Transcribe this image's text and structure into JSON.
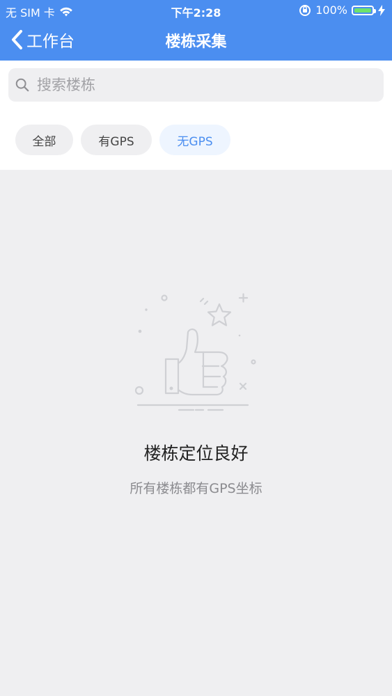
{
  "status_bar": {
    "carrier": "无 SIM 卡",
    "time": "下午2:28",
    "battery": "100%",
    "icons": [
      "wifi-icon",
      "orientation-lock-icon",
      "battery-icon",
      "charging-icon"
    ]
  },
  "nav": {
    "back_label": "工作台",
    "title": "楼栋采集",
    "back_icon": "chevron-left-icon"
  },
  "search": {
    "value": "",
    "placeholder": "搜索楼栋",
    "icon": "search-icon"
  },
  "filters": {
    "selected": "无GPS",
    "items": [
      {
        "label": "全部"
      },
      {
        "label": "有GPS"
      },
      {
        "label": "无GPS"
      }
    ]
  },
  "empty_state": {
    "illustration": "thumbs-up-icon",
    "title": "楼栋定位良好",
    "subtitle": "所有楼栋都有GPS坐标"
  },
  "colors": {
    "accent": "#4b8ef0",
    "background": "#efeff1",
    "panel": "#ffffff",
    "selected_chip_bg": "#eef5ff",
    "selected_chip_text": "#4b8ef0",
    "title_text": "#222222",
    "subtitle_text": "#8b8b8f"
  }
}
